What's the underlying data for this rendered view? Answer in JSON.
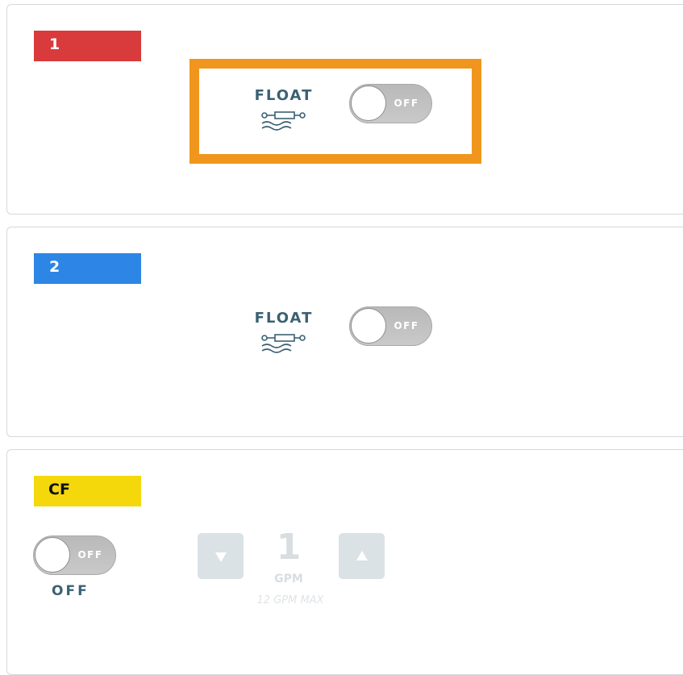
{
  "cards": [
    {
      "badge": "1",
      "badge_color": "#d93a3c",
      "control": {
        "label": "FLOAT",
        "icon": "float-cylinder-icon",
        "toggle_state": "OFF",
        "toggle_on": false
      }
    },
    {
      "badge": "2",
      "badge_color": "#2d86e6",
      "control": {
        "label": "FLOAT",
        "icon": "float-cylinder-icon",
        "toggle_state": "OFF",
        "toggle_on": false
      }
    },
    {
      "badge": "CF",
      "badge_color": "#f4d80c",
      "toggle_state": "OFF",
      "toggle_on": false,
      "status_label": "OFF",
      "flow": {
        "value": "1",
        "unit": "GPM",
        "max_text": "12 GPM MAX",
        "decrease_icon": "triangle-down-icon",
        "increase_icon": "triangle-up-icon",
        "enabled": false
      }
    }
  ],
  "highlight_color": "#f0961e"
}
